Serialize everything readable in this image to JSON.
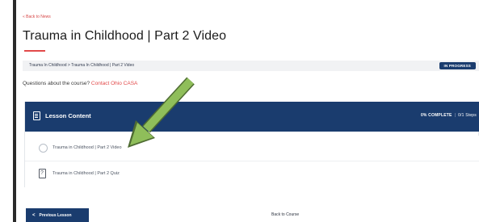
{
  "nav": {
    "back_label": "« Back to News"
  },
  "page": {
    "title": "Trauma in Childhood | Part 2 Video"
  },
  "breadcrumb": {
    "text": "Trauma In Childhood > Trauma In Childhood | Part 2 Video"
  },
  "status": {
    "badge": "IN PROGRESS"
  },
  "questions": {
    "prompt": "Questions about the course? ",
    "contact_link": "Contact Ohio CASA"
  },
  "lesson_panel": {
    "title": "Lesson Content",
    "progress": "0% COMPLETE",
    "steps": "0/1 Steps",
    "items": [
      {
        "label": "Trauma in Childhood | Part 2 Video",
        "icon": "circle-icon"
      },
      {
        "label": "Trauma in Childhood | Part 2 Quiz",
        "icon": "quiz-icon"
      }
    ]
  },
  "footer": {
    "prev_label": "Previous Lesson",
    "back_course": "Back to Course"
  },
  "colors": {
    "primary": "#1a3c6e",
    "accent": "#e24a4a",
    "annotation_arrow": "#8fbe5a"
  }
}
